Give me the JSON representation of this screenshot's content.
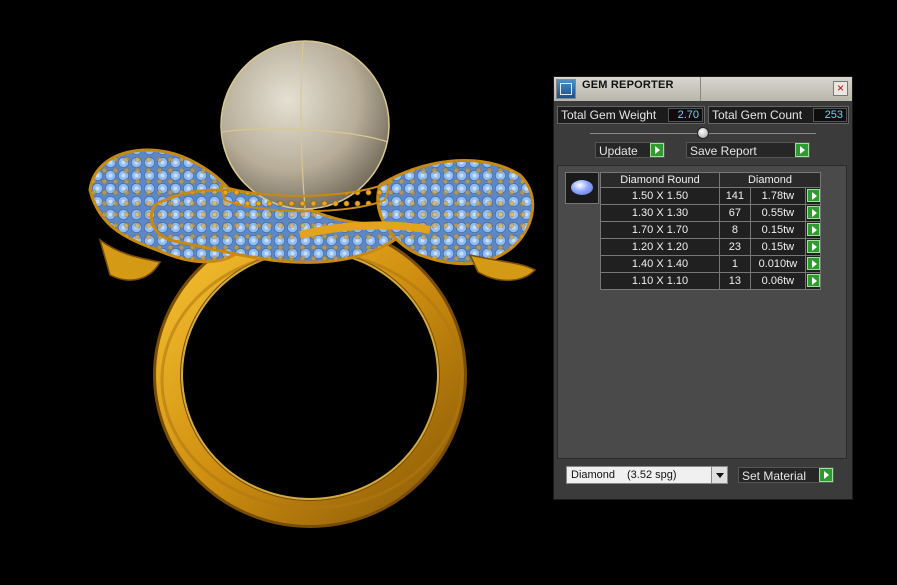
{
  "panel": {
    "title": "GEM REPORTER",
    "close_label": "×",
    "total_gem_weight_label": "Total Gem Weight",
    "total_gem_weight_value": "2.70",
    "total_gem_count_label": "Total Gem Count",
    "total_gem_count_value": "253",
    "update_label": "Update",
    "save_report_label": "Save Report",
    "table": {
      "headers": [
        "Diamond Round",
        "Diamond"
      ],
      "rows": [
        {
          "size": "1.50 X 1.50",
          "count": "141",
          "weight": "1.78tw"
        },
        {
          "size": "1.30 X 1.30",
          "count": "67",
          "weight": "0.55tw"
        },
        {
          "size": "1.70 X 1.70",
          "count": "8",
          "weight": "0.15tw"
        },
        {
          "size": "1.20 X 1.20",
          "count": "23",
          "weight": "0.15tw"
        },
        {
          "size": "1.40 X 1.40",
          "count": "1",
          "weight": "0.010tw"
        },
        {
          "size": "1.10 X 1.10",
          "count": "13",
          "weight": "0.06tw"
        }
      ]
    },
    "material_name": "Diamond",
    "material_spg": "(3.52 spg)",
    "set_material_label": "Set Material"
  },
  "colors": {
    "gold": "#e0a21c",
    "gem_blue": "#7fb2f5",
    "pearl": "#b7ad98",
    "accent_value": "#6fd0ff",
    "go_green": "#2e9b2e"
  },
  "icons": [
    "gem-reporter-icon",
    "close-icon",
    "play-arrow-icon",
    "dropdown-arrow-icon",
    "gem-thumbnail-icon"
  ]
}
